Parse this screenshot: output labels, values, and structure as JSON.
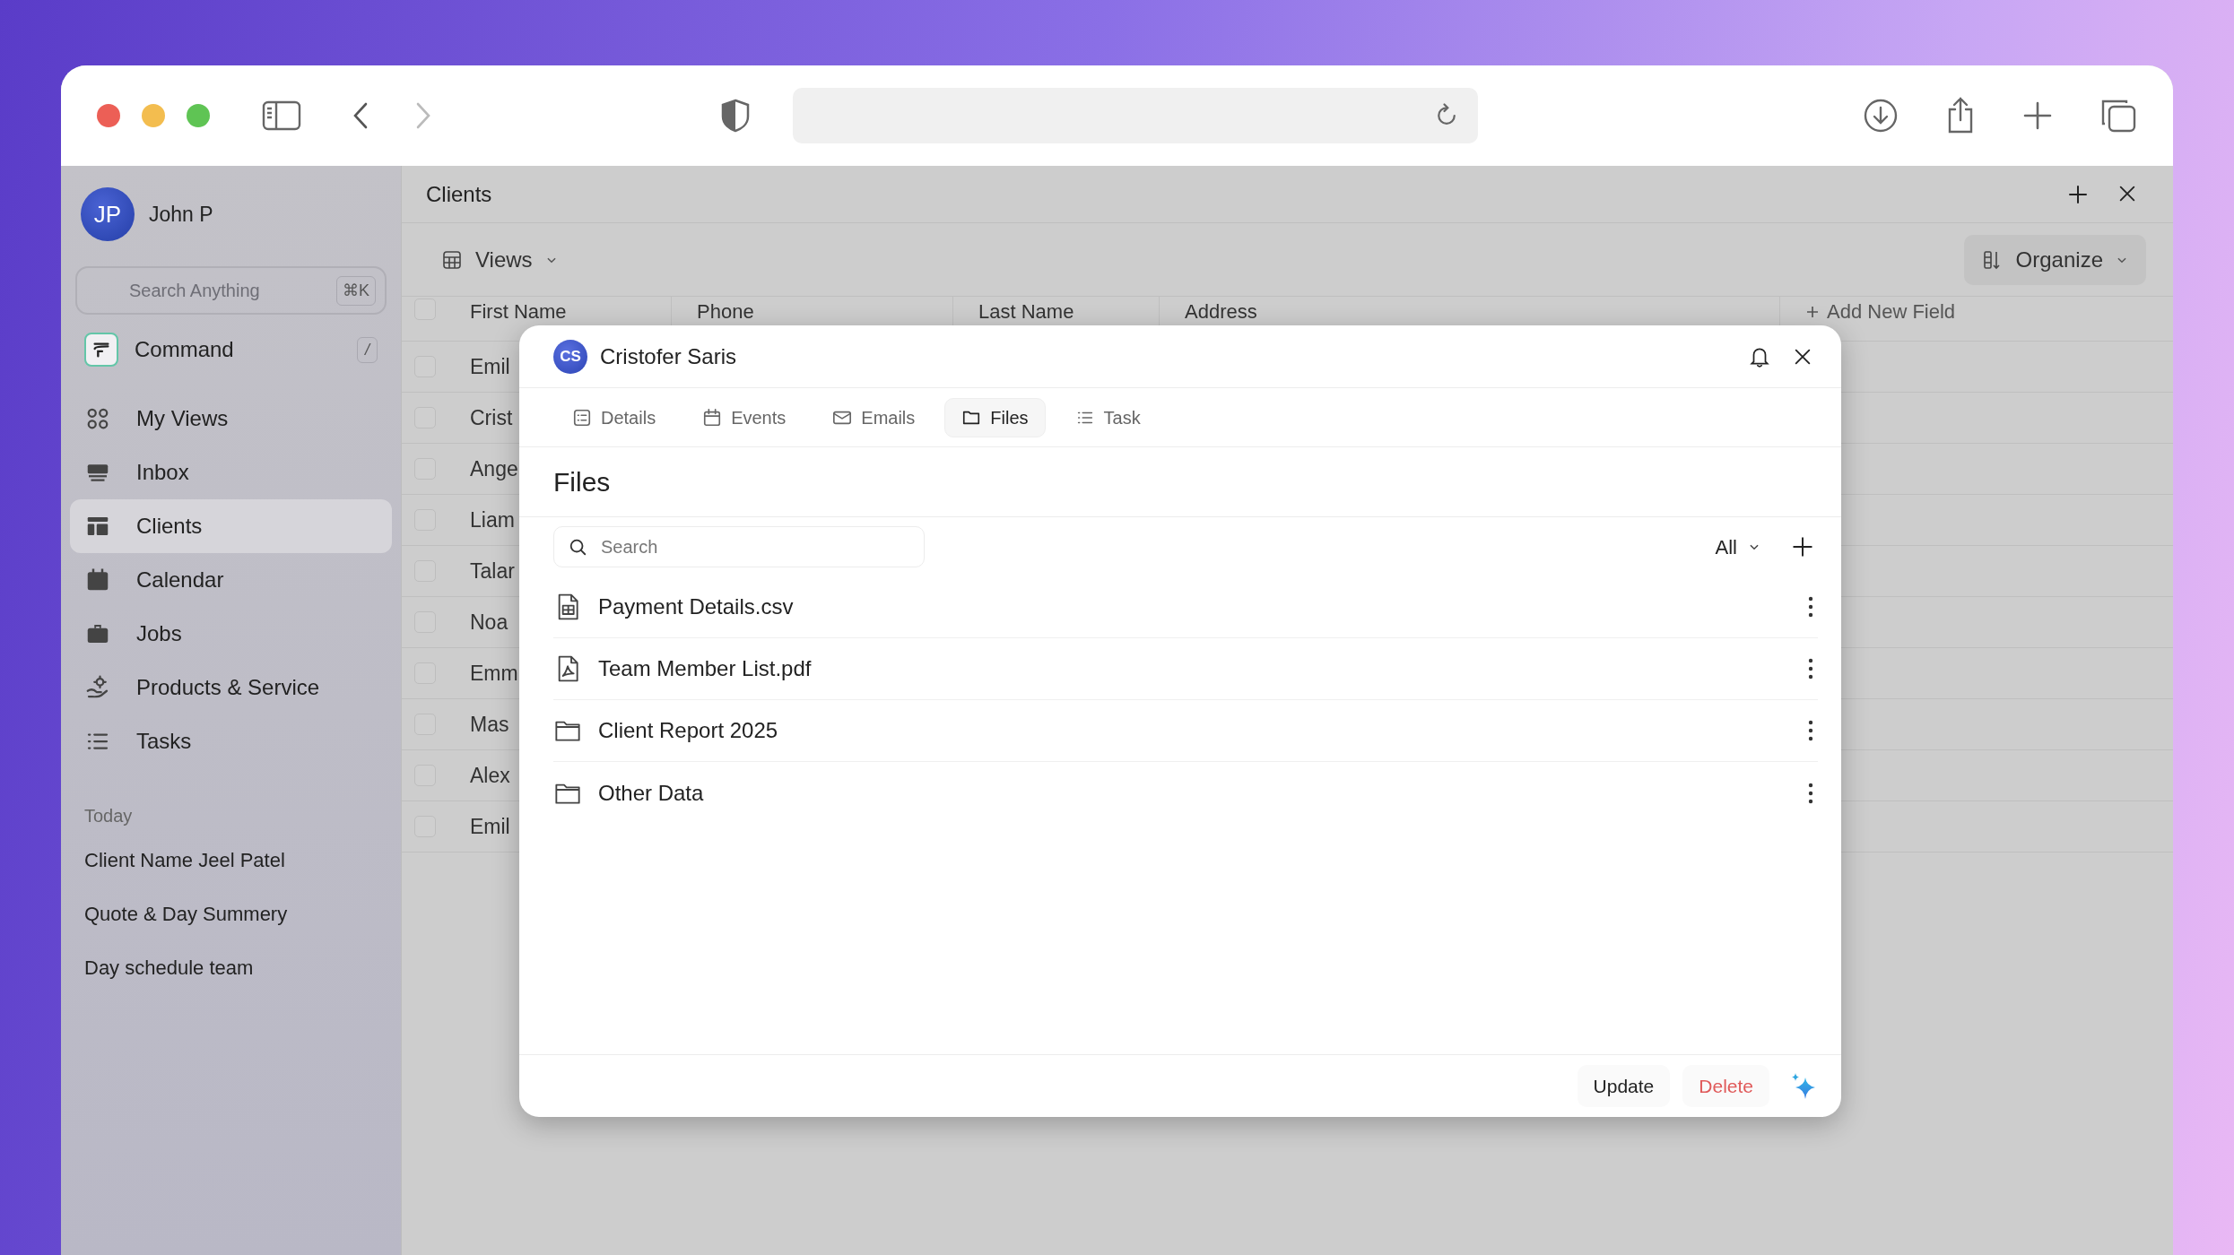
{
  "sidebar": {
    "user": {
      "initials": "JP",
      "name": "John P"
    },
    "search": {
      "placeholder": "Search Anything",
      "shortcut": "⌘K"
    },
    "command": {
      "label": "Command",
      "shortcut": "/"
    },
    "nav": [
      {
        "label": "My Views",
        "selected": false
      },
      {
        "label": "Inbox",
        "selected": false
      },
      {
        "label": "Clients",
        "selected": true
      },
      {
        "label": "Calendar",
        "selected": false
      },
      {
        "label": "Jobs",
        "selected": false
      },
      {
        "label": "Products & Service",
        "selected": false
      },
      {
        "label": "Tasks",
        "selected": false
      }
    ],
    "section_title": "Today",
    "recent": [
      "Client Name Jeel Patel",
      "Quote & Day Summery",
      "Day schedule team"
    ]
  },
  "panel": {
    "title": "Clients",
    "views_label": "Views",
    "organize_label": "Organize",
    "table": {
      "header_checked": false,
      "columns": [
        "First Name",
        "Phone",
        "Last Name",
        "Address"
      ],
      "add_field": "Add New Field",
      "rows": [
        {
          "first_name": "Emil",
          "checked": false
        },
        {
          "first_name": "Crist",
          "checked": false
        },
        {
          "first_name": "Ange",
          "checked": false
        },
        {
          "first_name": "Liam",
          "checked": false
        },
        {
          "first_name": "Talar",
          "checked": false
        },
        {
          "first_name": "Noa",
          "checked": false
        },
        {
          "first_name": "Emm",
          "checked": false
        },
        {
          "first_name": "Mas",
          "checked": false
        },
        {
          "first_name": "Alex",
          "checked": false
        },
        {
          "first_name": "Emil",
          "checked": false
        }
      ]
    }
  },
  "dialog": {
    "avatar_initials": "CS",
    "title": "Cristofer Saris",
    "tabs": [
      {
        "label": "Details",
        "selected": false
      },
      {
        "label": "Events",
        "selected": false
      },
      {
        "label": "Emails",
        "selected": false
      },
      {
        "label": "Files",
        "selected": true
      },
      {
        "label": "Task",
        "selected": false
      }
    ],
    "section_title": "Files",
    "search": {
      "placeholder": "Search"
    },
    "filter": "All",
    "files": [
      {
        "name": "Payment Details.csv",
        "kind": "sheet"
      },
      {
        "name": "Team Member List.pdf",
        "kind": "pdf"
      },
      {
        "name": "Client Report 2025",
        "kind": "folder"
      },
      {
        "name": "Other Data",
        "kind": "folder"
      }
    ],
    "buttons": [
      {
        "label": "Update",
        "kind": "normal"
      },
      {
        "label": "Delete",
        "kind": "danger"
      }
    ]
  }
}
